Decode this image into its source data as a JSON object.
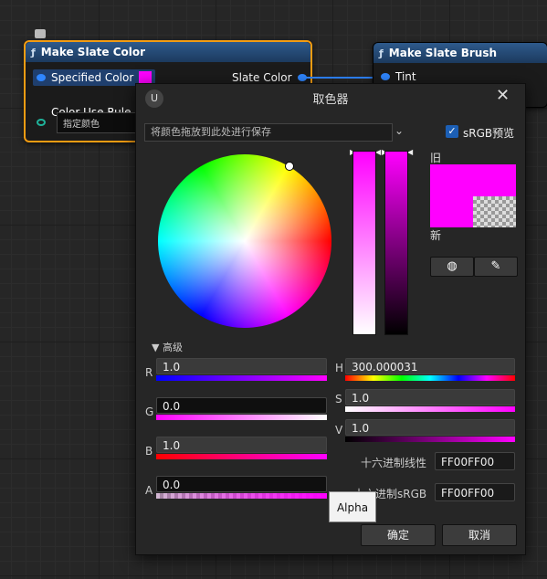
{
  "nodes": {
    "make_color": {
      "title": "Make Slate Color",
      "specified_color_label": "Specified Color",
      "slate_color_label": "Slate Color",
      "color_use_rule_label": "Color Use Rule",
      "color_use_rule_value": "指定颜色"
    },
    "make_brush": {
      "title": "Make Slate Brush",
      "tint_label": "Tint"
    }
  },
  "dialog": {
    "title": "取色器",
    "save_placeholder": "将颜色拖放到此处进行保存",
    "srgb_preview_label": "sRGB预览",
    "old_label": "旧",
    "new_label": "新",
    "advanced_label": "高级",
    "fields": {
      "r": {
        "label": "R",
        "value": "1.0"
      },
      "g": {
        "label": "G",
        "value": "0.0"
      },
      "b": {
        "label": "B",
        "value": "1.0"
      },
      "a": {
        "label": "A",
        "value": "0.0"
      },
      "h": {
        "label": "H",
        "value": "300.000031"
      },
      "s": {
        "label": "S",
        "value": "1.0"
      },
      "v": {
        "label": "V",
        "value": "1.0"
      }
    },
    "hex_linear": {
      "label": "十六进制线性",
      "value": "FF00FF00"
    },
    "hex_srgb": {
      "label": "十六进制sRGB",
      "value": "FF00FF00"
    },
    "ok_label": "确定",
    "cancel_label": "取消",
    "tooltip": "Alpha"
  },
  "colors": {
    "accent": "#2f86ff",
    "selected_border": "#f39c12",
    "current_color": "#ff00ff"
  }
}
